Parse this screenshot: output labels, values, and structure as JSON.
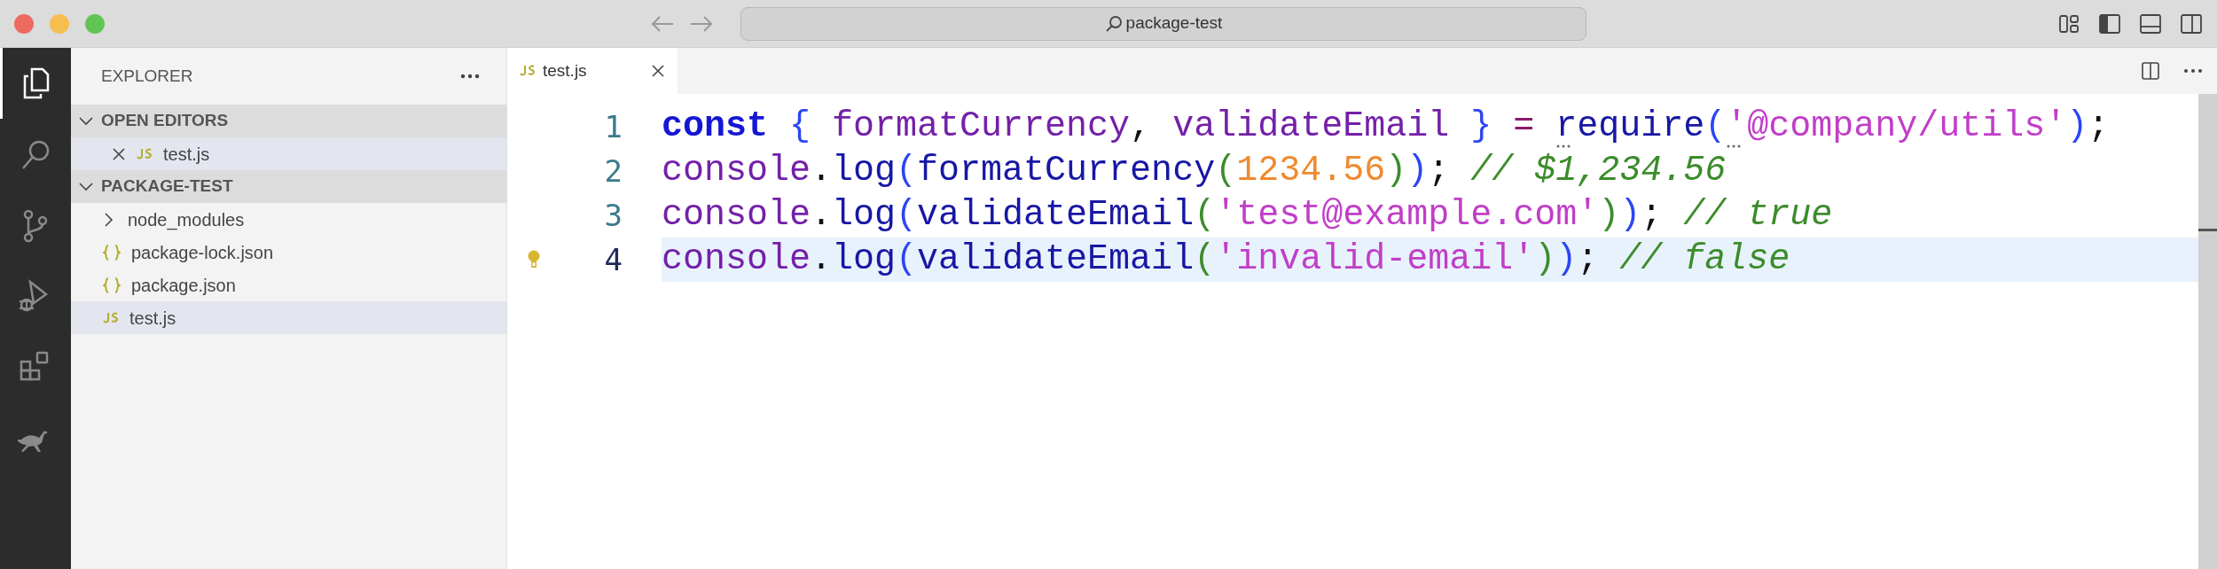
{
  "window": {
    "title": "package-test"
  },
  "activity_bar": [
    {
      "selected": true
    },
    {
      "selected": false
    },
    {
      "selected": false
    },
    {
      "selected": false
    },
    {
      "selected": false
    },
    {
      "selected": false
    }
  ],
  "sidebar": {
    "title": "EXPLORER",
    "sections": [
      {
        "title": "OPEN EDITORS",
        "kind": "open-editors",
        "expanded": true,
        "items": [
          {
            "label": "test.js",
            "kind": "js",
            "selected": true
          }
        ]
      },
      {
        "title": "PACKAGE-TEST",
        "kind": "folder",
        "expanded": true,
        "items": [
          {
            "label": "node_modules",
            "kind": "folder",
            "expanded": false,
            "selected": false
          },
          {
            "label": "package-lock.json",
            "kind": "json",
            "selected": false
          },
          {
            "label": "package.json",
            "kind": "json",
            "selected": false
          },
          {
            "label": "test.js",
            "kind": "js",
            "selected": true
          }
        ]
      }
    ]
  },
  "editor": {
    "tabs": [
      {
        "label": "test.js",
        "kind": "js",
        "selected": true
      }
    ],
    "lines": [
      {
        "number": "1",
        "active": false,
        "lightbulb": false,
        "tokens": [
          {
            "kind": "keyword",
            "text": "const"
          },
          {
            "kind": "bracket1",
            "text": " {"
          },
          {
            "kind": "variable",
            "text": " formatCurrency"
          },
          {
            "kind": "punct",
            "text": ","
          },
          {
            "kind": "variable",
            "text": " validateEmail"
          },
          {
            "kind": "bracket1",
            "text": " }"
          },
          {
            "kind": "operator",
            "text": " = "
          },
          {
            "kind": "function",
            "text": "require",
            "hint": true
          },
          {
            "kind": "bracket1",
            "text": "("
          },
          {
            "kind": "string",
            "text": "'@company/utils'",
            "hint": true
          },
          {
            "kind": "bracket1",
            "text": ")"
          },
          {
            "kind": "punct",
            "text": ";"
          }
        ]
      },
      {
        "number": "2",
        "active": false,
        "lightbulb": false,
        "tokens": [
          {
            "kind": "variable",
            "text": "console"
          },
          {
            "kind": "punct",
            "text": "."
          },
          {
            "kind": "function",
            "text": "log"
          },
          {
            "kind": "bracket1",
            "text": "("
          },
          {
            "kind": "function",
            "text": "formatCurrency"
          },
          {
            "kind": "bracket2",
            "text": "("
          },
          {
            "kind": "number",
            "text": "1234.56"
          },
          {
            "kind": "bracket2",
            "text": ")"
          },
          {
            "kind": "bracket1",
            "text": ")"
          },
          {
            "kind": "punct",
            "text": ";"
          },
          {
            "kind": "comment",
            "text": " // $1,234.56"
          }
        ]
      },
      {
        "number": "3",
        "active": false,
        "lightbulb": false,
        "tokens": [
          {
            "kind": "variable",
            "text": "console"
          },
          {
            "kind": "punct",
            "text": "."
          },
          {
            "kind": "function",
            "text": "log"
          },
          {
            "kind": "bracket1",
            "text": "("
          },
          {
            "kind": "function",
            "text": "validateEmail"
          },
          {
            "kind": "bracket2",
            "text": "("
          },
          {
            "kind": "string",
            "text": "'test@example.com'"
          },
          {
            "kind": "bracket2",
            "text": ")"
          },
          {
            "kind": "bracket1",
            "text": ")"
          },
          {
            "kind": "punct",
            "text": ";"
          },
          {
            "kind": "comment",
            "text": " // true"
          }
        ]
      },
      {
        "number": "4",
        "active": true,
        "lightbulb": true,
        "tokens": [
          {
            "kind": "variable",
            "text": "console"
          },
          {
            "kind": "punct",
            "text": "."
          },
          {
            "kind": "function",
            "text": "log"
          },
          {
            "kind": "bracket1",
            "text": "("
          },
          {
            "kind": "function",
            "text": "validateEmail"
          },
          {
            "kind": "bracket2",
            "text": "("
          },
          {
            "kind": "string",
            "text": "'invalid-email'"
          },
          {
            "kind": "bracket2",
            "text": ")"
          },
          {
            "kind": "bracket1",
            "text": ")"
          },
          {
            "kind": "punct",
            "text": ";"
          },
          {
            "kind": "comment",
            "text": " // false"
          }
        ]
      }
    ]
  }
}
